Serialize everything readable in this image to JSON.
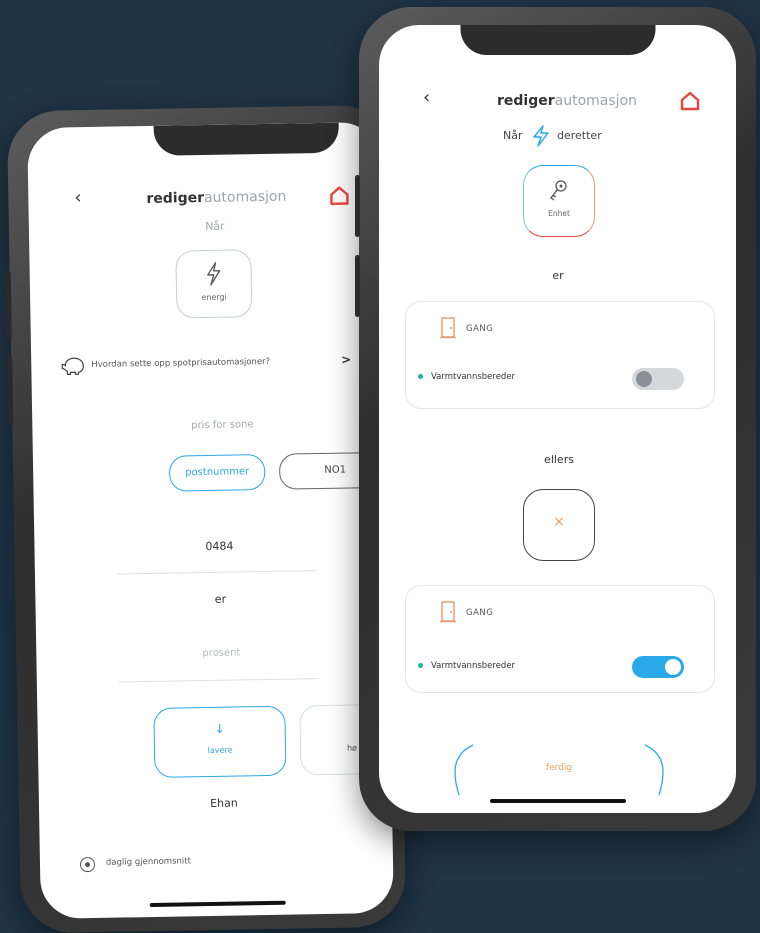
{
  "colors": {
    "background": "#1f3446",
    "accent_blue": "#2aa9e8",
    "brand_red": "#e8453c",
    "accent_orange": "#f0a258",
    "teal": "#1fb5a3"
  },
  "left_screen": {
    "header": {
      "title_bold": "rediger",
      "title_light": "automasjon",
      "back_icon": "chevron-left-icon",
      "home_icon": "house-icon"
    },
    "when_label": "Når",
    "trigger": {
      "icon": "lightning-icon",
      "label": "energi"
    },
    "help_link": {
      "icon": "piggy-bank-icon",
      "text": "Hvordan sette opp spotprisautomasjoner?",
      "chevron": ">"
    },
    "zone_label": "pris for sone",
    "zone_tabs": [
      "postnummer",
      "NO1"
    ],
    "postcode_value": "0484",
    "is_label": "er",
    "percent_placeholder": "prosent",
    "direction_options": [
      {
        "icon": "arrow-down-icon",
        "label": "lavere"
      },
      {
        "label": "hø"
      }
    ],
    "than_label": "Ehan",
    "average_option": "daglig gjennomsnitt"
  },
  "right_screen": {
    "header": {
      "title_bold": "rediger",
      "title_light": "automasjon",
      "back_icon": "chevron-left-icon",
      "home_icon": "house-icon"
    },
    "when_label": "Når",
    "then_label": "deretter",
    "device_button": {
      "icon": "key-icon",
      "label": "Enhet"
    },
    "is_label": "er",
    "cards": [
      {
        "door_icon": "door-icon",
        "room": "GANG",
        "device": "Varmtvannsbereder",
        "toggle_on": false
      },
      {
        "door_icon": "door-icon",
        "room": "GANG",
        "device": "Varmtvannsbereder",
        "toggle_on": true
      }
    ],
    "else_label": "ellers",
    "remove_button": {
      "icon": "close-icon",
      "label": "×"
    },
    "done_button": "ferdig"
  }
}
